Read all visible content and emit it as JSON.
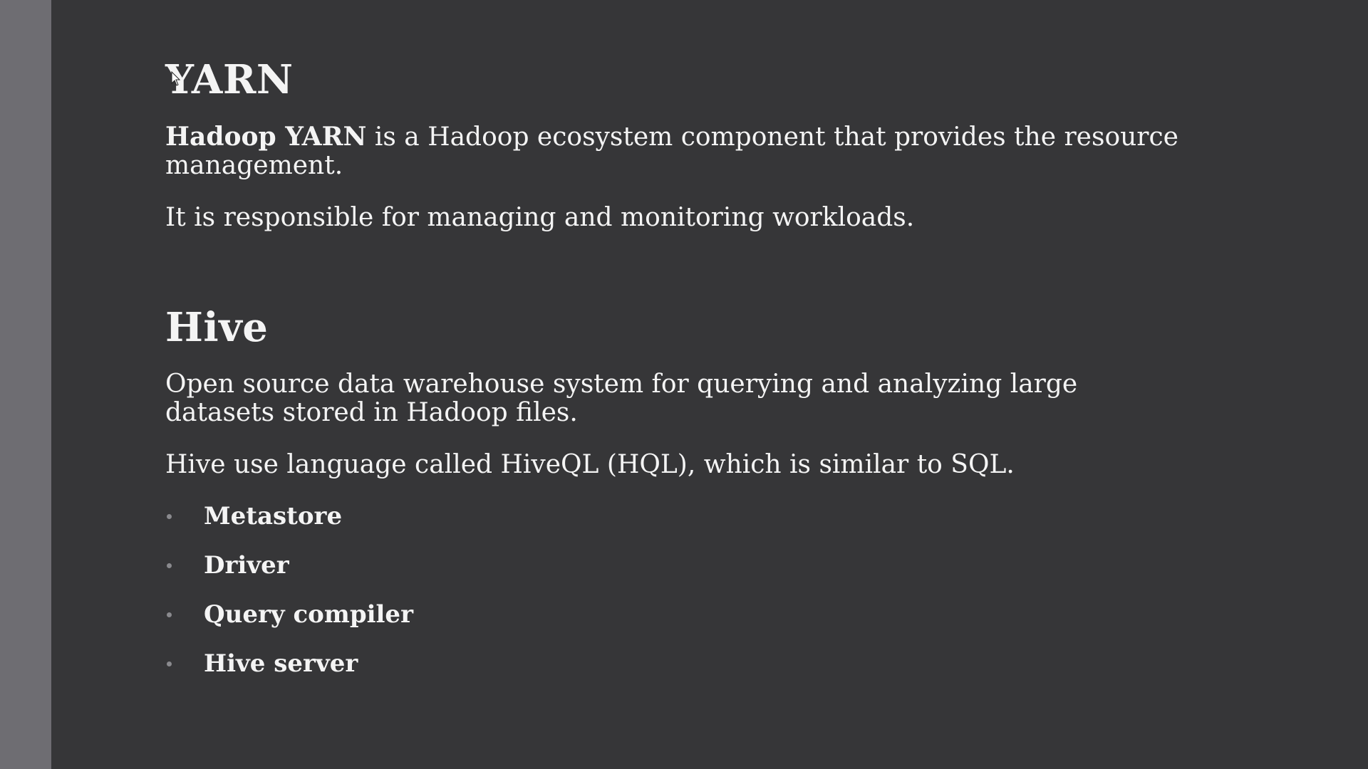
{
  "slide": {
    "yarn": {
      "title": "YARN",
      "p1_bold": "Hadoop YARN",
      "p1_rest": " is a Hadoop ecosystem component that provides the resource management.",
      "p2": "It is responsible for managing and monitoring workloads."
    },
    "hive": {
      "title": "Hive",
      "p1": "Open source data warehouse system for querying and analyzing large datasets stored in Hadoop files.",
      "p2": "Hive use language called HiveQL (HQL), which is similar to SQL.",
      "items": [
        {
          "label": "Metastore"
        },
        {
          "label": "Driver"
        },
        {
          "label": "Query compiler"
        },
        {
          "label": "Hive server"
        }
      ]
    }
  },
  "colors": {
    "background": "#363638",
    "sidebar": "#6e6d72",
    "text": "#f4f4f4",
    "bullet": "#8a8a8e"
  },
  "icons": {
    "cursor": "mouse-pointer-icon"
  }
}
